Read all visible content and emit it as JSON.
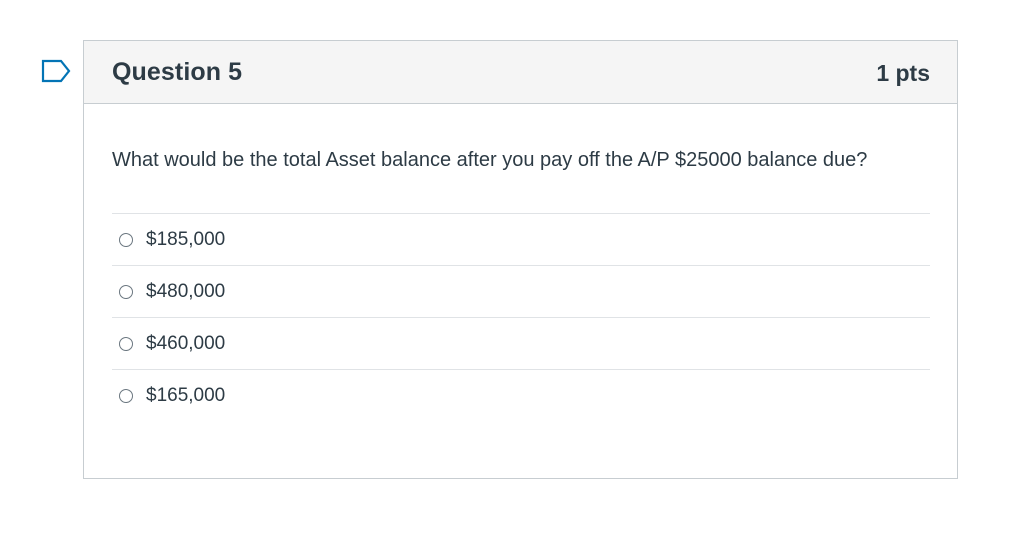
{
  "question": {
    "title": "Question 5",
    "points": "1 pts",
    "text": "What would be the total Asset balance after you pay off the A/P $25000 balance due?",
    "flag_icon": "flag-icon",
    "answers": [
      {
        "label": "$185,000"
      },
      {
        "label": "$480,000"
      },
      {
        "label": "$460,000"
      },
      {
        "label": "$165,000"
      }
    ]
  },
  "colors": {
    "flag_outline": "#0374b5",
    "header_bg": "#f5f5f5",
    "border": "#c7cdd1",
    "text": "#2d3b45"
  }
}
